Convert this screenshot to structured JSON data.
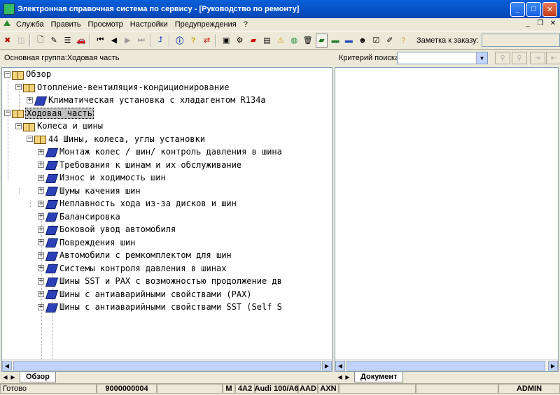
{
  "window": {
    "title": "Электронная справочная система по сервису - [Руководство по ремонту]"
  },
  "menu": [
    "Служба",
    "Править",
    "Просмотр",
    "Настройки",
    "Предупреждения",
    "?"
  ],
  "toolbar": {
    "order_note_label": "Заметка к заказу:",
    "order_note_value": ""
  },
  "info": {
    "group_label": "Основная группа:Ходовая часть",
    "search_label": "Критерий поиска:",
    "search_value": ""
  },
  "tree": [
    {
      "text": "Обзор",
      "level": 0,
      "icon": "book-open-icon",
      "expanded": true
    },
    {
      "text": "Отопление-вентиляция-кондиционирование",
      "level": 1,
      "icon": "book-open-icon",
      "expanded": true
    },
    {
      "text": "Климатическая установка с хладагентом R134a",
      "level": 2,
      "icon": "book-closed-icon",
      "expanded": false
    },
    {
      "text": "Ходовая часть",
      "level": 0,
      "icon": "book-open-icon",
      "expanded": true,
      "selected": true
    },
    {
      "text": "Колеса и шины",
      "level": 1,
      "icon": "book-open-icon",
      "expanded": true
    },
    {
      "text": "44 Шины, колеса, углы установки",
      "level": 2,
      "icon": "book-open-icon",
      "expanded": true
    },
    {
      "text": "Монтаж колес / шин/ контроль давления в шина",
      "level": 3,
      "icon": "book-closed-icon",
      "expanded": false
    },
    {
      "text": "Требования к шинам и их обслуживание",
      "level": 3,
      "icon": "book-closed-icon",
      "expanded": false
    },
    {
      "text": "Износ и ходимость шин",
      "level": 3,
      "icon": "book-closed-icon",
      "expanded": false
    },
    {
      "text": "Шумы качения шин",
      "level": 3,
      "icon": "book-closed-icon",
      "expanded": false
    },
    {
      "text": "Неплавность хода из-за дисков и шин",
      "level": 3,
      "icon": "book-closed-icon",
      "expanded": false
    },
    {
      "text": "Балансировка",
      "level": 3,
      "icon": "book-closed-icon",
      "expanded": false
    },
    {
      "text": "Боковой увод автомобиля",
      "level": 3,
      "icon": "book-closed-icon",
      "expanded": false
    },
    {
      "text": "Повреждения шин",
      "level": 3,
      "icon": "book-closed-icon",
      "expanded": false
    },
    {
      "text": "Автомобили с ремкомплектом для шин",
      "level": 3,
      "icon": "book-closed-icon",
      "expanded": false
    },
    {
      "text": "Системы контроля давления в шинах",
      "level": 3,
      "icon": "book-closed-icon",
      "expanded": false
    },
    {
      "text": "Шины SST и PAX с возможностью продолжение дв",
      "level": 3,
      "icon": "book-closed-icon",
      "expanded": false
    },
    {
      "text": "Шины с антиаварийными свойствами (PAX)",
      "level": 3,
      "icon": "book-closed-icon",
      "expanded": false
    },
    {
      "text": "Шины с антиаварийными свойствами SST (Self S",
      "level": 3,
      "icon": "book-closed-icon",
      "expanded": false
    }
  ],
  "tabs": {
    "left": "Обзор",
    "right": "Документ"
  },
  "status": [
    "Готово",
    "9000000004",
    "",
    "M",
    "4A2",
    "Audi 100/A6",
    "AAD",
    "AXN",
    "",
    "",
    "ADMIN"
  ]
}
